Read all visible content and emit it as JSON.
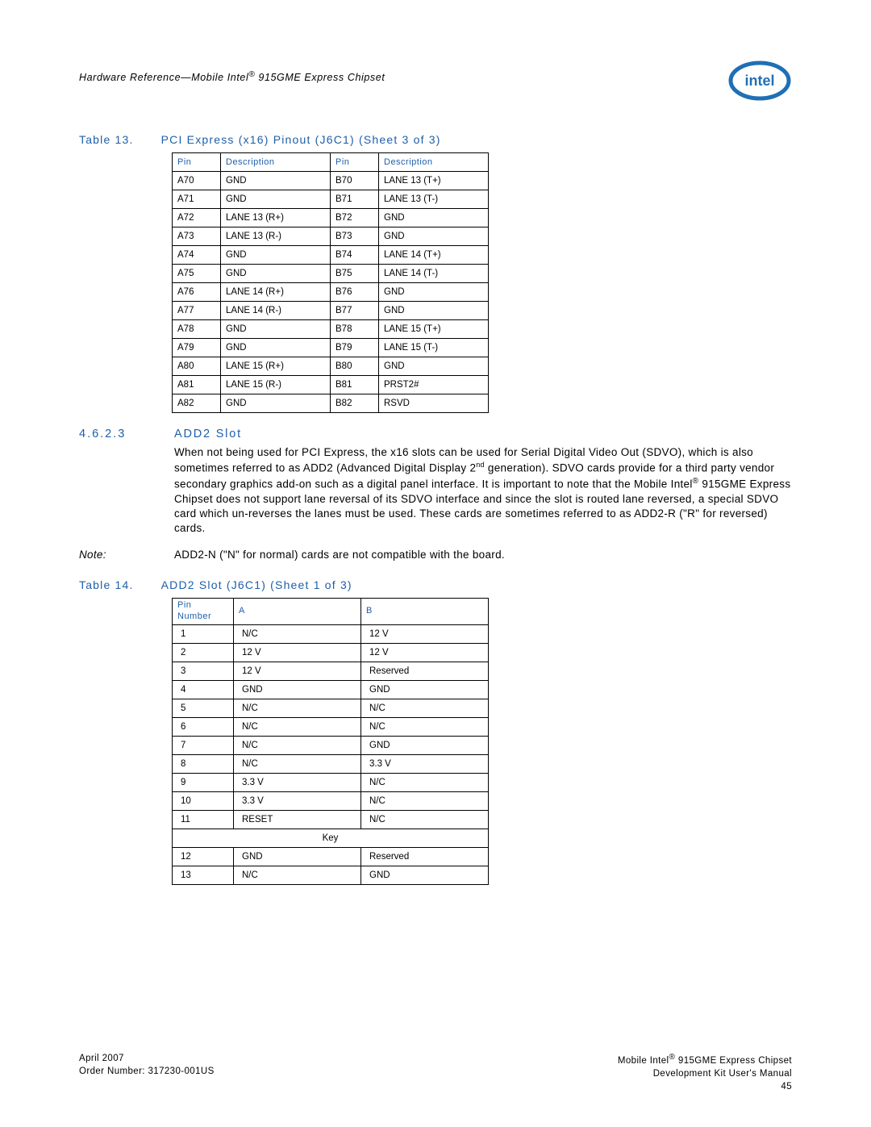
{
  "header": {
    "doc_title_pre": "Hardware Reference—Mobile Intel",
    "doc_title_post": " 915GME Express Chipset",
    "reg": "®"
  },
  "table13": {
    "caption_num": "Table 13.",
    "caption_text": "PCI Express (x16) Pinout (J6C1) (Sheet 3 of 3)",
    "headers": [
      "Pin",
      "Description",
      "Pin",
      "Description"
    ],
    "rows": [
      [
        "A70",
        "GND",
        "B70",
        "LANE 13 (T+)"
      ],
      [
        "A71",
        "GND",
        "B71",
        "LANE 13 (T-)"
      ],
      [
        "A72",
        "LANE 13 (R+)",
        "B72",
        "GND"
      ],
      [
        "A73",
        "LANE 13 (R-)",
        "B73",
        "GND"
      ],
      [
        "A74",
        "GND",
        "B74",
        "LANE 14 (T+)"
      ],
      [
        "A75",
        "GND",
        "B75",
        "LANE 14 (T-)"
      ],
      [
        "A76",
        "LANE 14 (R+)",
        "B76",
        "GND"
      ],
      [
        "A77",
        "LANE 14 (R-)",
        "B77",
        "GND"
      ],
      [
        "A78",
        "GND",
        "B78",
        "LANE 15 (T+)"
      ],
      [
        "A79",
        "GND",
        "B79",
        "LANE 15 (T-)"
      ],
      [
        "A80",
        "LANE 15 (R+)",
        "B80",
        "GND"
      ],
      [
        "A81",
        "LANE 15 (R-)",
        "B81",
        "PRST2#"
      ],
      [
        "A82",
        "GND",
        "B82",
        "RSVD"
      ]
    ]
  },
  "section": {
    "num": "4.6.2.3",
    "title": "ADD2 Slot",
    "para_a": "When not being used for PCI Express, the x16 slots can be used for Serial Digital Video Out (SDVO), which is also sometimes referred to as ADD2 (Advanced Digital Display 2",
    "para_b": " generation). SDVO cards provide for a third party vendor secondary graphics add-on such as a digital panel interface. It is important to note that the Mobile Intel",
    "para_c": " 915GME Express Chipset  does not support lane reversal of its SDVO interface and since the slot is routed lane reversed, a special SDVO card which un-reverses the lanes must be used. These cards are sometimes referred to as ADD2-R (\"R\" for reversed) cards.",
    "sup_nd": "nd",
    "reg": "®"
  },
  "note": {
    "label": "Note:",
    "text": "ADD2-N (\"N\" for normal) cards are not compatible with the board."
  },
  "table14": {
    "caption_num": "Table 14.",
    "caption_text": "ADD2 Slot (J6C1) (Sheet 1 of 3)",
    "headers": [
      "Pin Number",
      "A",
      "B"
    ],
    "rows_top": [
      [
        "1",
        "N/C",
        "12 V"
      ],
      [
        "2",
        "12 V",
        "12 V"
      ],
      [
        "3",
        "12 V",
        "Reserved"
      ],
      [
        "4",
        "GND",
        "GND"
      ],
      [
        "5",
        "N/C",
        "N/C"
      ],
      [
        "6",
        "N/C",
        "N/C"
      ],
      [
        "7",
        "N/C",
        "GND"
      ],
      [
        "8",
        "N/C",
        "3.3 V"
      ],
      [
        "9",
        "3.3 V",
        "N/C"
      ],
      [
        "10",
        "3.3 V",
        "N/C"
      ],
      [
        "11",
        "RESET",
        "N/C"
      ]
    ],
    "key_label": "Key",
    "rows_bottom": [
      [
        "12",
        "GND",
        "Reserved"
      ],
      [
        "13",
        "N/C",
        "GND"
      ]
    ]
  },
  "footer": {
    "left_line1": "April 2007",
    "left_line2": "Order Number: 317230-001US",
    "right_line1_pre": "Mobile Intel",
    "right_line1_post": " 915GME Express Chipset",
    "right_line2": "Development Kit User's Manual",
    "right_line3": "45",
    "reg": "®"
  }
}
